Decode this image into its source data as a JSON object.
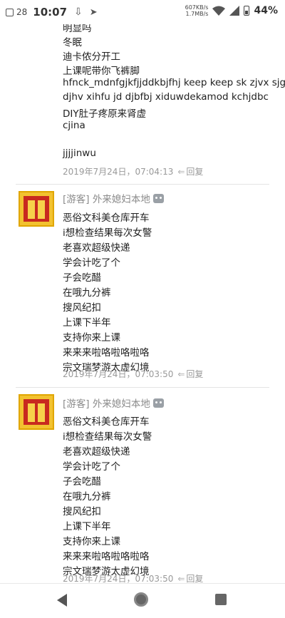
{
  "status_bar": {
    "date_badge": "28",
    "time": "10:07",
    "speed_up": "607KB/s",
    "speed_down": "1.7MB/s",
    "battery": "44%"
  },
  "post0": {
    "lines": [
      "明显吗",
      "冬眠",
      "迪卡侬分开工",
      "上课呢带你飞裤脚",
      "hfnck_mdnfgjkfjjddkbjfhj keep keep sk zjvx sjgd",
      "djhv xihfu jd djbfbj xiduwdekamod kchjdbc",
      "DIY肚子疼原来肾虚",
      "cjina",
      "",
      "jjjjinwu"
    ],
    "timestamp": "2019年7月24日，07:04:13",
    "reply": "回复"
  },
  "post1": {
    "author": "[游客] 外来媳妇本地",
    "lines": [
      "恶俗文科美仓库开车",
      "i想检查结果每次女警",
      "老喜欢超级快递",
      "学会计吃了个",
      "子会吃醋",
      "在哦九分裤",
      "搜风纪扣",
      "上课下半年",
      "支持你来上课",
      "来来来啦咯啦咯啦咯",
      "宗文瑞梦游太虚幻境"
    ],
    "timestamp": "2019年7月24日，07:03:50",
    "reply": "回复"
  },
  "post2": {
    "author": "[游客] 外来媳妇本地",
    "lines": [
      "恶俗文科美仓库开车",
      "i想检查结果每次女警",
      "老喜欢超级快递",
      "学会计吃了个",
      "子会吃醋",
      "在哦九分裤",
      "搜风纪扣",
      "上课下半年",
      "支持你来上课",
      "来来来啦咯啦咯啦咯",
      "宗文瑞梦游太虚幻境"
    ],
    "timestamp": "2019年7月24日，07:03:50",
    "reply": "回复"
  }
}
